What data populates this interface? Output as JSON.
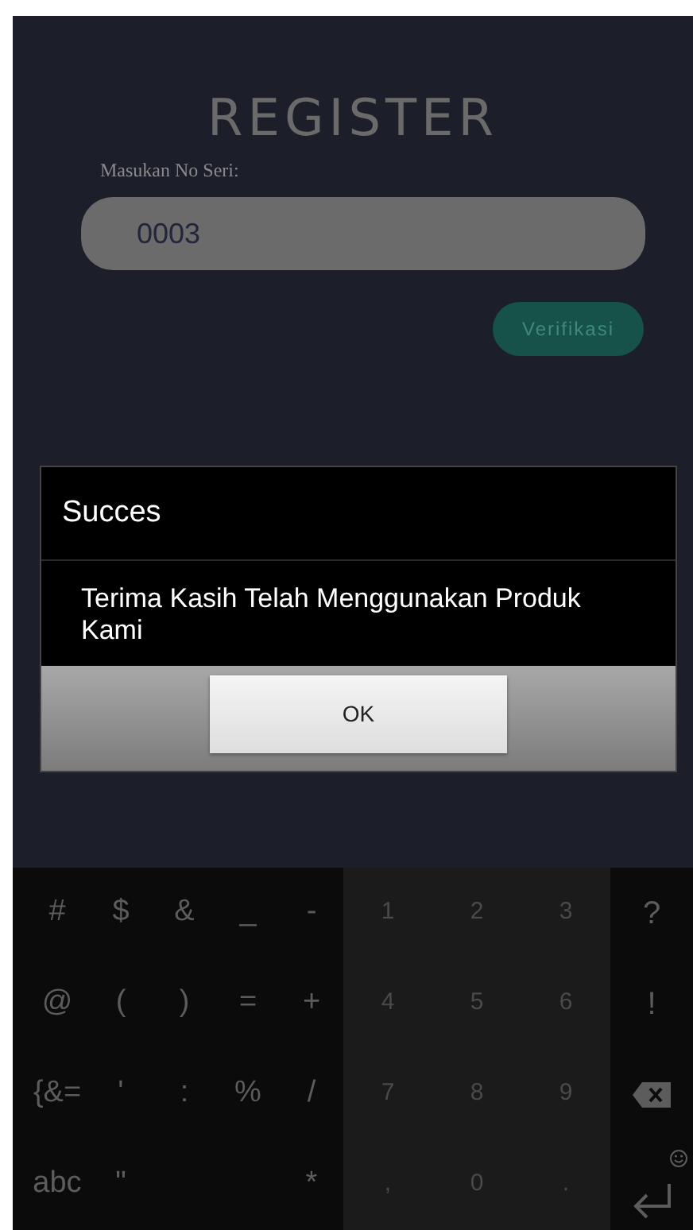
{
  "screen": {
    "title": "REGISTER",
    "field_label": "Masukan No Seri:",
    "field_value": "0003",
    "verify_button": "Verifikasi"
  },
  "dialog": {
    "title": "Succes",
    "message": "Terima Kasih Telah Menggunakan Produk Kami",
    "button": "OK"
  },
  "keyboard": {
    "rows": [
      {
        "symbols": [
          {
            "kind": "char",
            "label": "#"
          },
          {
            "kind": "char",
            "label": "$"
          },
          {
            "kind": "char",
            "label": "&"
          },
          {
            "kind": "char",
            "label": "_"
          },
          {
            "kind": "char",
            "label": "-"
          }
        ],
        "digits": [
          "1",
          "2",
          "3"
        ],
        "action": {
          "kind": "char",
          "label": "?"
        }
      },
      {
        "symbols": [
          {
            "kind": "char",
            "label": "@"
          },
          {
            "kind": "char",
            "label": "("
          },
          {
            "kind": "char",
            "label": ")"
          },
          {
            "kind": "char",
            "label": "="
          },
          {
            "kind": "char",
            "label": "+"
          }
        ],
        "digits": [
          "4",
          "5",
          "6"
        ],
        "action": {
          "kind": "char",
          "label": "!"
        }
      },
      {
        "symbols": [
          {
            "kind": "char",
            "label": "{&="
          },
          {
            "kind": "char",
            "label": "'"
          },
          {
            "kind": "char",
            "label": ":"
          },
          {
            "kind": "char",
            "label": "%"
          },
          {
            "kind": "char",
            "label": "/"
          }
        ],
        "digits": [
          "7",
          "8",
          "9"
        ],
        "action": {
          "kind": "backspace"
        }
      },
      {
        "symbols": [
          {
            "kind": "char",
            "label": "abc"
          },
          {
            "kind": "char",
            "label": "\""
          },
          {
            "kind": "spacer"
          },
          {
            "kind": "spacer"
          },
          {
            "kind": "char",
            "label": "*"
          }
        ],
        "digits": [
          ",",
          "0",
          "."
        ],
        "action": {
          "kind": "enter"
        }
      }
    ]
  }
}
